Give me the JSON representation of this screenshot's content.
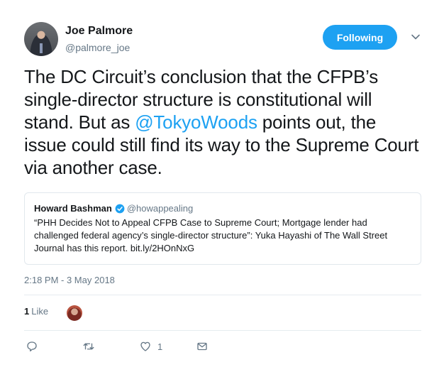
{
  "author": {
    "name": "Joe Palmore",
    "handle": "@palmore_joe",
    "follow_label": "Following"
  },
  "tweet": {
    "text_before": "The DC Circuit’s conclusion that the CFPB’s single-director structure is constitutional will stand. But as ",
    "mention": "@TokyoWoods",
    "text_after": " points out, the issue could still find its way to the Supreme Court via another case."
  },
  "quote": {
    "name": "Howard Bashman",
    "handle": "@howappealing",
    "body": "“PHH Decides Not to Appeal CFPB Case to Supreme Court; Mortgage lender had challenged federal agency’s single-director structure”: Yuka Hayashi of The Wall Street Journal has this report. bit.ly/2HOnNxG"
  },
  "meta": {
    "timestamp": "2:18 PM - 3 May 2018",
    "likes_count": "1",
    "likes_label": "Like"
  },
  "actions": {
    "like_count": "1"
  },
  "icons": {
    "caret": "chevron-down-icon",
    "verified": "verified-badge-icon",
    "reply": "reply-icon",
    "retweet": "retweet-icon",
    "like": "heart-icon",
    "dm": "envelope-icon"
  },
  "colors": {
    "accent": "#1da1f2",
    "secondary_text": "#657786",
    "border": "#e1e8ed"
  }
}
